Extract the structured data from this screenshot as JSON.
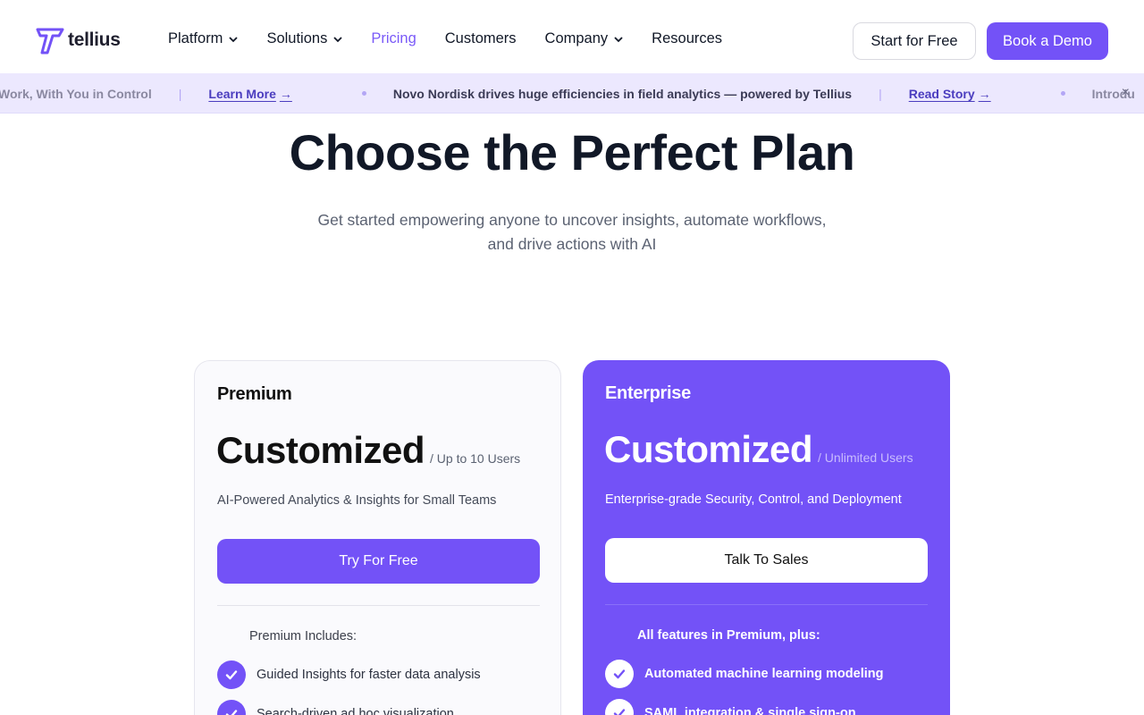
{
  "nav": {
    "logo_text": "tellius",
    "menu": [
      {
        "label": "Platform",
        "has_dropdown": true
      },
      {
        "label": "Solutions",
        "has_dropdown": true
      },
      {
        "label": "Pricing",
        "has_dropdown": false,
        "active": true
      },
      {
        "label": "Customers",
        "has_dropdown": false
      },
      {
        "label": "Company",
        "has_dropdown": true
      },
      {
        "label": "Resources",
        "has_dropdown": false
      }
    ],
    "start_free_label": "Start for Free",
    "book_demo_label": "Book a Demo"
  },
  "ticker": {
    "items": [
      {
        "text": "Work, With You in Control",
        "link": "Learn More"
      },
      {
        "text": "Novo Nordisk drives huge efficiencies in field analytics — powered by Tellius",
        "link": "Read Story"
      },
      {
        "text": "Introdu",
        "link": ""
      }
    ],
    "close_glyph": "×"
  },
  "hero": {
    "title": "Choose the Perfect Plan",
    "subtitle": "Get started empowering anyone to uncover insights, automate workflows, and drive actions with AI"
  },
  "plans": [
    {
      "name": "Premium",
      "price": "Customized",
      "per": "/ Up to 10 Users",
      "tagline": "AI-Powered Analytics & Insights for Small Teams",
      "cta": "Try For Free",
      "includes_label": "Premium Includes:",
      "features": [
        "Guided Insights for faster data analysis",
        "Search-driven ad hoc visualization"
      ]
    },
    {
      "name": "Enterprise",
      "price": "Customized",
      "per": "/ Unlimited Users",
      "tagline": "Enterprise-grade Security, Control, and Deployment",
      "cta": "Talk To Sales",
      "includes_label": "All features in Premium, plus:",
      "features": [
        "Automated machine learning modeling",
        "SAML integration & single sign-on"
      ]
    }
  ],
  "colors": {
    "brand": "#7352f7",
    "active_link": "#7a5af8",
    "ticker_bg": "#ece8fe",
    "text_dark": "#111827",
    "text_muted": "#5b6272"
  }
}
